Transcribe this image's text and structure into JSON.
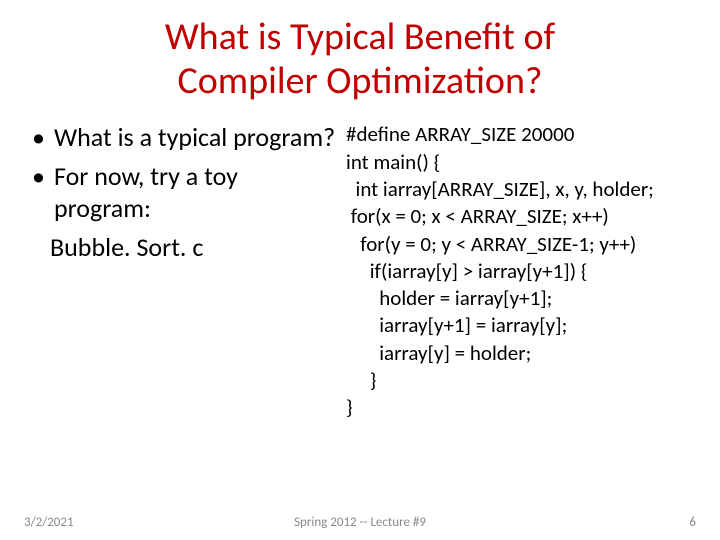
{
  "title": {
    "line1": "What is Typical Benefit of",
    "line2": "Compiler Optimization?"
  },
  "left": {
    "bullet1": "What is a typical program?",
    "bullet2": "For now, try a toy program:",
    "subline": "Bubble. Sort. c"
  },
  "code": {
    "l1": "#define ARRAY_SIZE 20000",
    "l2": "int main() {",
    "l3": "  int iarray[ARRAY_SIZE], x, y, holder;",
    "l4": " for(x = 0; x < ARRAY_SIZE; x++)",
    "l5": "   for(y = 0; y < ARRAY_SIZE-1; y++)",
    "l6": "     if(iarray[y] > iarray[y+1]) {",
    "l7": "       holder = iarray[y+1];",
    "l8": "       iarray[y+1] = iarray[y];",
    "l9": "       iarray[y] = holder;",
    "l10": "     }",
    "l11": "}"
  },
  "footer": {
    "date": "3/2/2021",
    "center": "Spring 2012 -- Lecture #9",
    "page": "6"
  }
}
